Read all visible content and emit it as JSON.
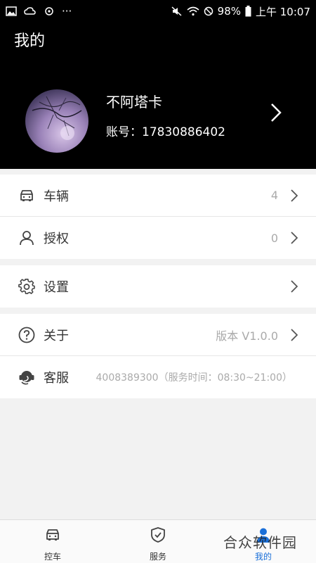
{
  "status_bar": {
    "battery": "98%",
    "time": "上午 10:07",
    "dots": "···"
  },
  "header": {
    "title": "我的",
    "user_name": "不阿塔卡",
    "account": "账号：17830886402"
  },
  "menu": {
    "vehicles": {
      "label": "车辆",
      "value": "4",
      "icon": "car-icon"
    },
    "authorization": {
      "label": "授权",
      "value": "0",
      "icon": "user-icon"
    },
    "settings": {
      "label": "设置",
      "icon": "gear-icon"
    },
    "about": {
      "label": "关于",
      "value": "版本 V1.0.0",
      "icon": "question-icon"
    },
    "service": {
      "label": "客服",
      "value": "4008389300（服务时间：08:30~21:00）",
      "icon": "headset-icon"
    }
  },
  "tabbar": {
    "tabs": [
      {
        "label": "控车",
        "icon": "car-icon"
      },
      {
        "label": "服务",
        "icon": "shield-check-icon"
      },
      {
        "label": "我的",
        "icon": "person-icon"
      }
    ]
  },
  "watermark": {
    "text": "合众软件园"
  },
  "colors": {
    "header_bg": "#000000",
    "page_bg": "#f2f2f2",
    "active_tab": "#1a6fd8"
  }
}
